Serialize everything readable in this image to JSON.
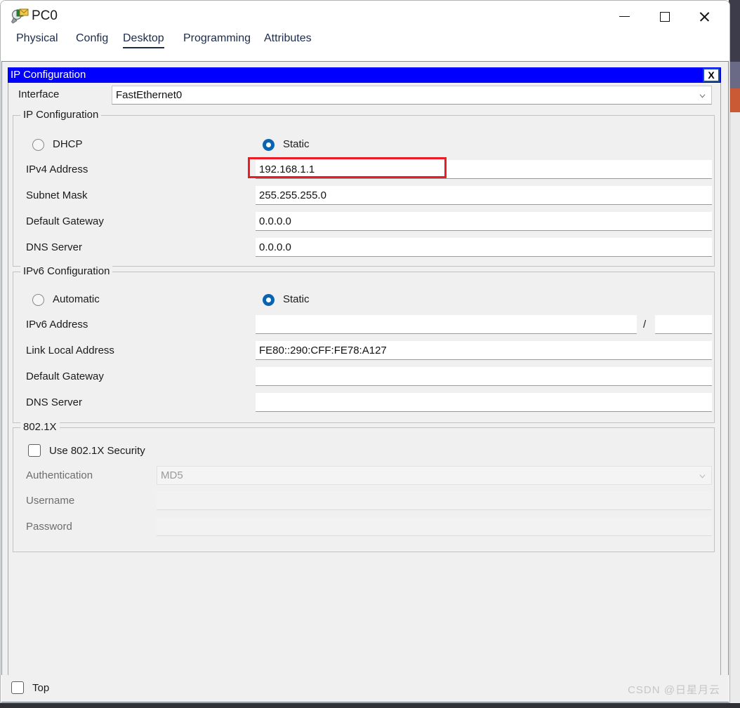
{
  "window": {
    "title": "PC0",
    "icon": "packet-tracer-inspect-icon",
    "minimize_label": "—",
    "maximize_label": "□",
    "close_label": "✕"
  },
  "tabs": [
    {
      "label": "Physical",
      "active": false
    },
    {
      "label": "Config",
      "active": false
    },
    {
      "label": "Desktop",
      "active": true
    },
    {
      "label": "Programming",
      "active": false
    },
    {
      "label": "Attributes",
      "active": false
    }
  ],
  "dialog": {
    "title": "IP Configuration",
    "close_label": "X",
    "interface": {
      "label": "Interface",
      "value": "FastEthernet0"
    },
    "ipv4_group": {
      "legend": "IP Configuration",
      "dhcp_label": "DHCP",
      "static_label": "Static",
      "selected": "static",
      "fields": [
        {
          "label": "IPv4 Address",
          "value": "192.168.1.1",
          "highlighted": true
        },
        {
          "label": "Subnet Mask",
          "value": "255.255.255.0",
          "highlighted": false
        },
        {
          "label": "Default Gateway",
          "value": "0.0.0.0",
          "highlighted": false
        },
        {
          "label": "DNS Server",
          "value": "0.0.0.0",
          "highlighted": false
        }
      ]
    },
    "ipv6_group": {
      "legend": "IPv6 Configuration",
      "automatic_label": "Automatic",
      "static_label": "Static",
      "selected": "static",
      "prefix_separator": "/",
      "fields": [
        {
          "label": "IPv6 Address",
          "value": ""
        },
        {
          "label": "Link Local Address",
          "value": "FE80::290:CFF:FE78:A127"
        },
        {
          "label": "Default Gateway",
          "value": ""
        },
        {
          "label": "DNS Server",
          "value": ""
        }
      ],
      "prefix_value": ""
    },
    "dot1x_group": {
      "legend": "802.1X",
      "use_security_label": "Use 802.1X Security",
      "use_security_checked": false,
      "authentication": {
        "label": "Authentication",
        "value": "MD5"
      },
      "username": {
        "label": "Username",
        "value": ""
      },
      "password": {
        "label": "Password",
        "value": ""
      }
    }
  },
  "bottom": {
    "top_checkbox_label": "Top",
    "top_checkbox_checked": false,
    "watermark": "CSDN @日星月云"
  },
  "colors": {
    "dialog_title_bg": "#0000ff",
    "radio_selected": "#0a63b0",
    "annotation": "#ec1c24",
    "tab_active": "#1b2b48"
  }
}
